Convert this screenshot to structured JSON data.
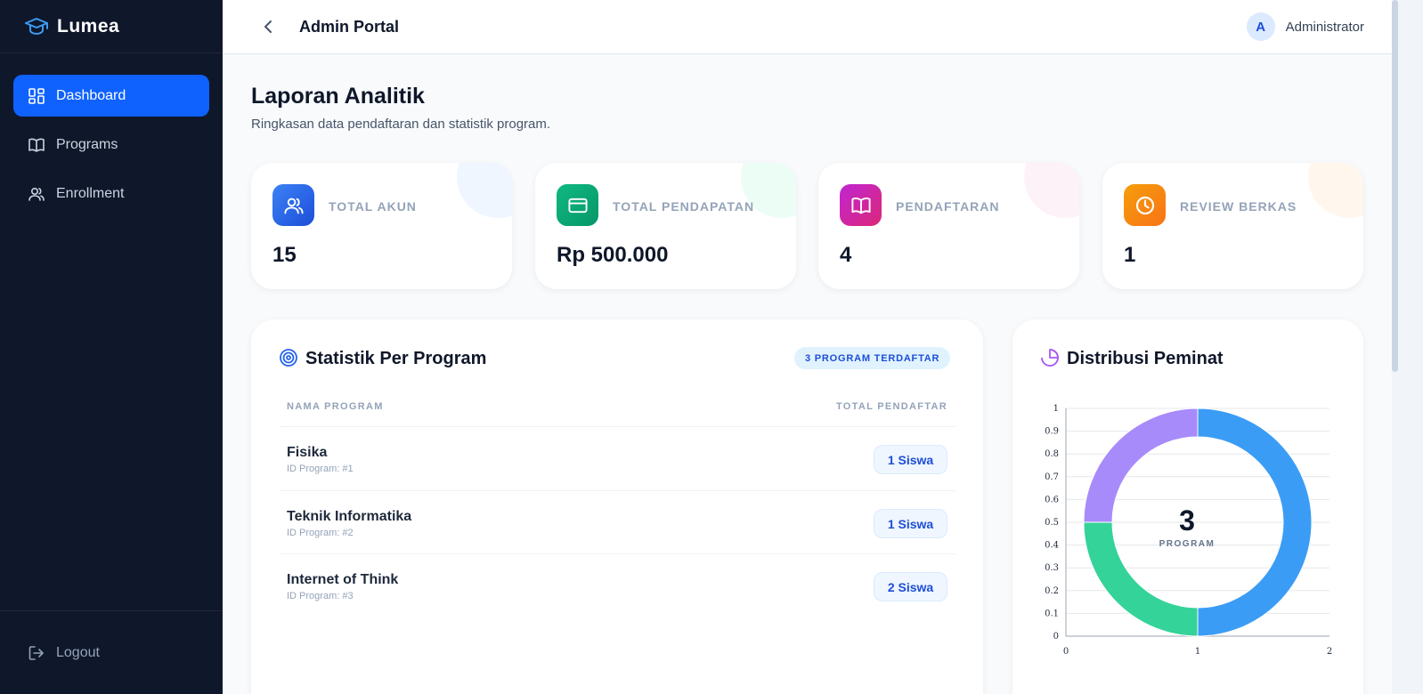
{
  "app": {
    "brand": "Lumea",
    "portal_title": "Admin Portal"
  },
  "sidebar": {
    "items": [
      {
        "label": "Dashboard",
        "icon": "dashboard-icon",
        "active": true
      },
      {
        "label": "Programs",
        "icon": "book-icon",
        "active": false
      },
      {
        "label": "Enrollment",
        "icon": "users-icon",
        "active": false
      }
    ],
    "logout_label": "Logout"
  },
  "user": {
    "initial": "A",
    "name": "Administrator"
  },
  "page": {
    "title": "Laporan Analitik",
    "subtitle": "Ringkasan data pendaftaran dan statistik program."
  },
  "stats": [
    {
      "label": "TOTAL AKUN",
      "value": "15",
      "icon": "users-icon",
      "color": "#2563eb"
    },
    {
      "label": "TOTAL PENDAPATAN",
      "value": "Rp 500.000",
      "icon": "credit-card-icon",
      "color": "#10b981"
    },
    {
      "label": "PENDAFTARAN",
      "value": "4",
      "icon": "book-open-icon",
      "color": "#c026d3"
    },
    {
      "label": "REVIEW BERKAS",
      "value": "1",
      "icon": "clock-icon",
      "color": "#f59e0b"
    }
  ],
  "program_stats": {
    "title": "Statistik Per Program",
    "badge": "3 PROGRAM TERDAFTAR",
    "columns": [
      "NAMA PROGRAM",
      "TOTAL PENDAFTAR"
    ],
    "rows": [
      {
        "name": "Fisika",
        "id": "ID Program: #1",
        "count": "1 Siswa"
      },
      {
        "name": "Teknik Informatika",
        "id": "ID Program: #2",
        "count": "1 Siswa"
      },
      {
        "name": "Internet of Think",
        "id": "ID Program: #3",
        "count": "2 Siswa"
      }
    ]
  },
  "distribution": {
    "title": "Distribusi Peminat",
    "center_value": "3",
    "center_label": "PROGRAM"
  },
  "chart_data": {
    "type": "pie",
    "title": "Distribusi Peminat",
    "categories": [
      "Fisika",
      "Teknik Informatika",
      "Internet of Think"
    ],
    "values": [
      1,
      1,
      2
    ],
    "colors": [
      "#a78bfa",
      "#34d399",
      "#3b9cf5"
    ],
    "donut": true,
    "xlim": [
      0,
      2
    ],
    "ylim": [
      0,
      1
    ],
    "x_ticks": [
      "0",
      "1",
      "2"
    ],
    "y_ticks": [
      "0",
      "0.1",
      "0.2",
      "0.3",
      "0.4",
      "0.5",
      "0.6",
      "0.7",
      "0.8",
      "0.9",
      "1"
    ],
    "grid": true
  }
}
